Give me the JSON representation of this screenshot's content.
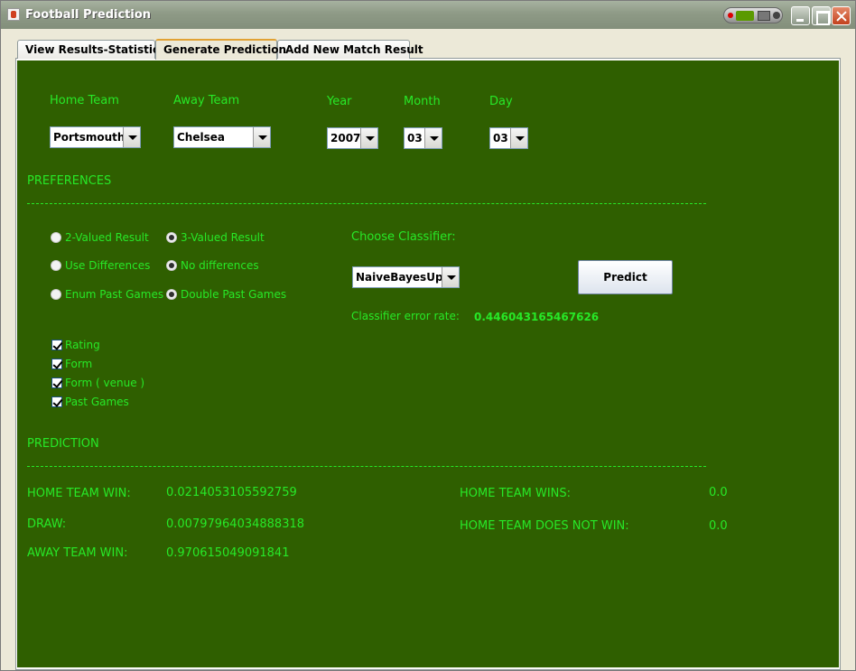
{
  "window": {
    "title": "Football Prediction"
  },
  "tabs": [
    {
      "label": "View Results-Statistics"
    },
    {
      "label": "Generate Prediction"
    },
    {
      "label": "Add New Match Result"
    }
  ],
  "match": {
    "home_team_label": "Home Team",
    "away_team_label": "Away Team",
    "year_label": "Year",
    "month_label": "Month",
    "day_label": "Day",
    "home_team": "Portsmouth",
    "away_team": "Chelsea",
    "year": "2007",
    "month": "03",
    "day": "03"
  },
  "preferences": {
    "heading": "PREFERENCES",
    "radio_2valued": "2-Valued Result",
    "radio_3valued": "3-Valued Result",
    "radio_use_diff": "Use Differences",
    "radio_no_diff": "No differences",
    "radio_enum_past": "Enum Past Games",
    "radio_double_past": "Double Past Games",
    "chk_rating": "Rating",
    "chk_form": "Form",
    "chk_form_venue": "Form ( venue )",
    "chk_past_games": "Past Games",
    "choose_classifier_label": "Choose Classifier:",
    "classifier": "NaiveBayesUp...",
    "predict_button": "Predict",
    "error_rate_label": "Classifier error rate:",
    "error_rate": "0.446043165467626"
  },
  "prediction": {
    "heading": "PREDICTION",
    "home_win_label": "HOME TEAM WIN:",
    "home_win": "0.0214053105592759",
    "draw_label": "DRAW:",
    "draw": "0.00797964034888318",
    "away_win_label": "AWAY TEAM WIN:",
    "away_win": "0.970615049091841",
    "home_wins_label": "HOME TEAM WINS:",
    "home_wins": "0.0",
    "home_not_win_label": "HOME TEAM DOES NOT WIN:",
    "home_not_win": "0.0"
  },
  "colors": {
    "panel_bg": "#2f5f00",
    "label_green": "#27e827"
  }
}
